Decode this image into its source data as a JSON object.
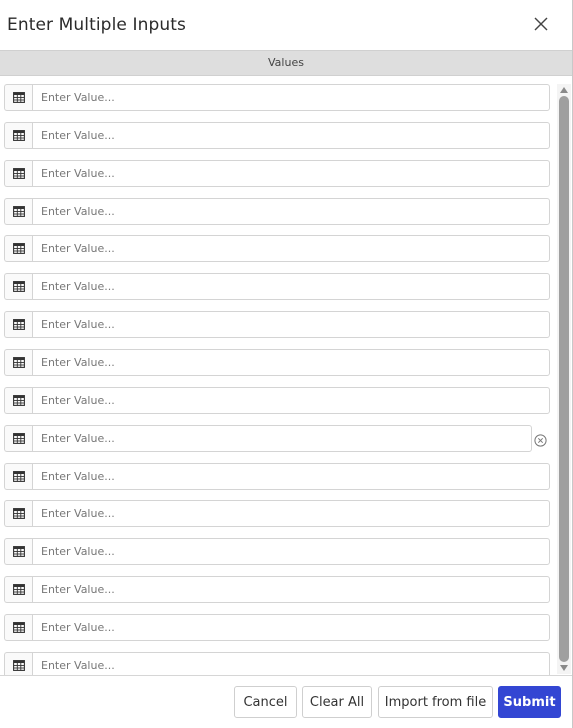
{
  "dialog": {
    "title": "Enter Multiple Inputs",
    "close_icon": "close-icon"
  },
  "table": {
    "column_header": "Values"
  },
  "rows": [
    {
      "value": "",
      "placeholder": "Enter Value..."
    },
    {
      "value": "",
      "placeholder": "Enter Value..."
    },
    {
      "value": "",
      "placeholder": "Enter Value..."
    },
    {
      "value": "",
      "placeholder": "Enter Value..."
    },
    {
      "value": "",
      "placeholder": "Enter Value..."
    },
    {
      "value": "",
      "placeholder": "Enter Value..."
    },
    {
      "value": "",
      "placeholder": "Enter Value..."
    },
    {
      "value": "",
      "placeholder": "Enter Value..."
    },
    {
      "value": "",
      "placeholder": "Enter Value..."
    },
    {
      "value": "",
      "placeholder": "Enter Value...",
      "has_clear": true
    },
    {
      "value": "",
      "placeholder": "Enter Value..."
    },
    {
      "value": "",
      "placeholder": "Enter Value..."
    },
    {
      "value": "",
      "placeholder": "Enter Value..."
    },
    {
      "value": "",
      "placeholder": "Enter Value..."
    },
    {
      "value": "",
      "placeholder": "Enter Value..."
    },
    {
      "value": "",
      "placeholder": "Enter Value..."
    }
  ],
  "row_icon": "table-icon",
  "clear_icon": "clear-circle-icon",
  "footer": {
    "cancel_label": "Cancel",
    "clear_all_label": "Clear All",
    "import_label": "Import from file",
    "submit_label": "Submit"
  },
  "colors": {
    "primary": "#3346d3",
    "header_bg": "#dedede"
  }
}
